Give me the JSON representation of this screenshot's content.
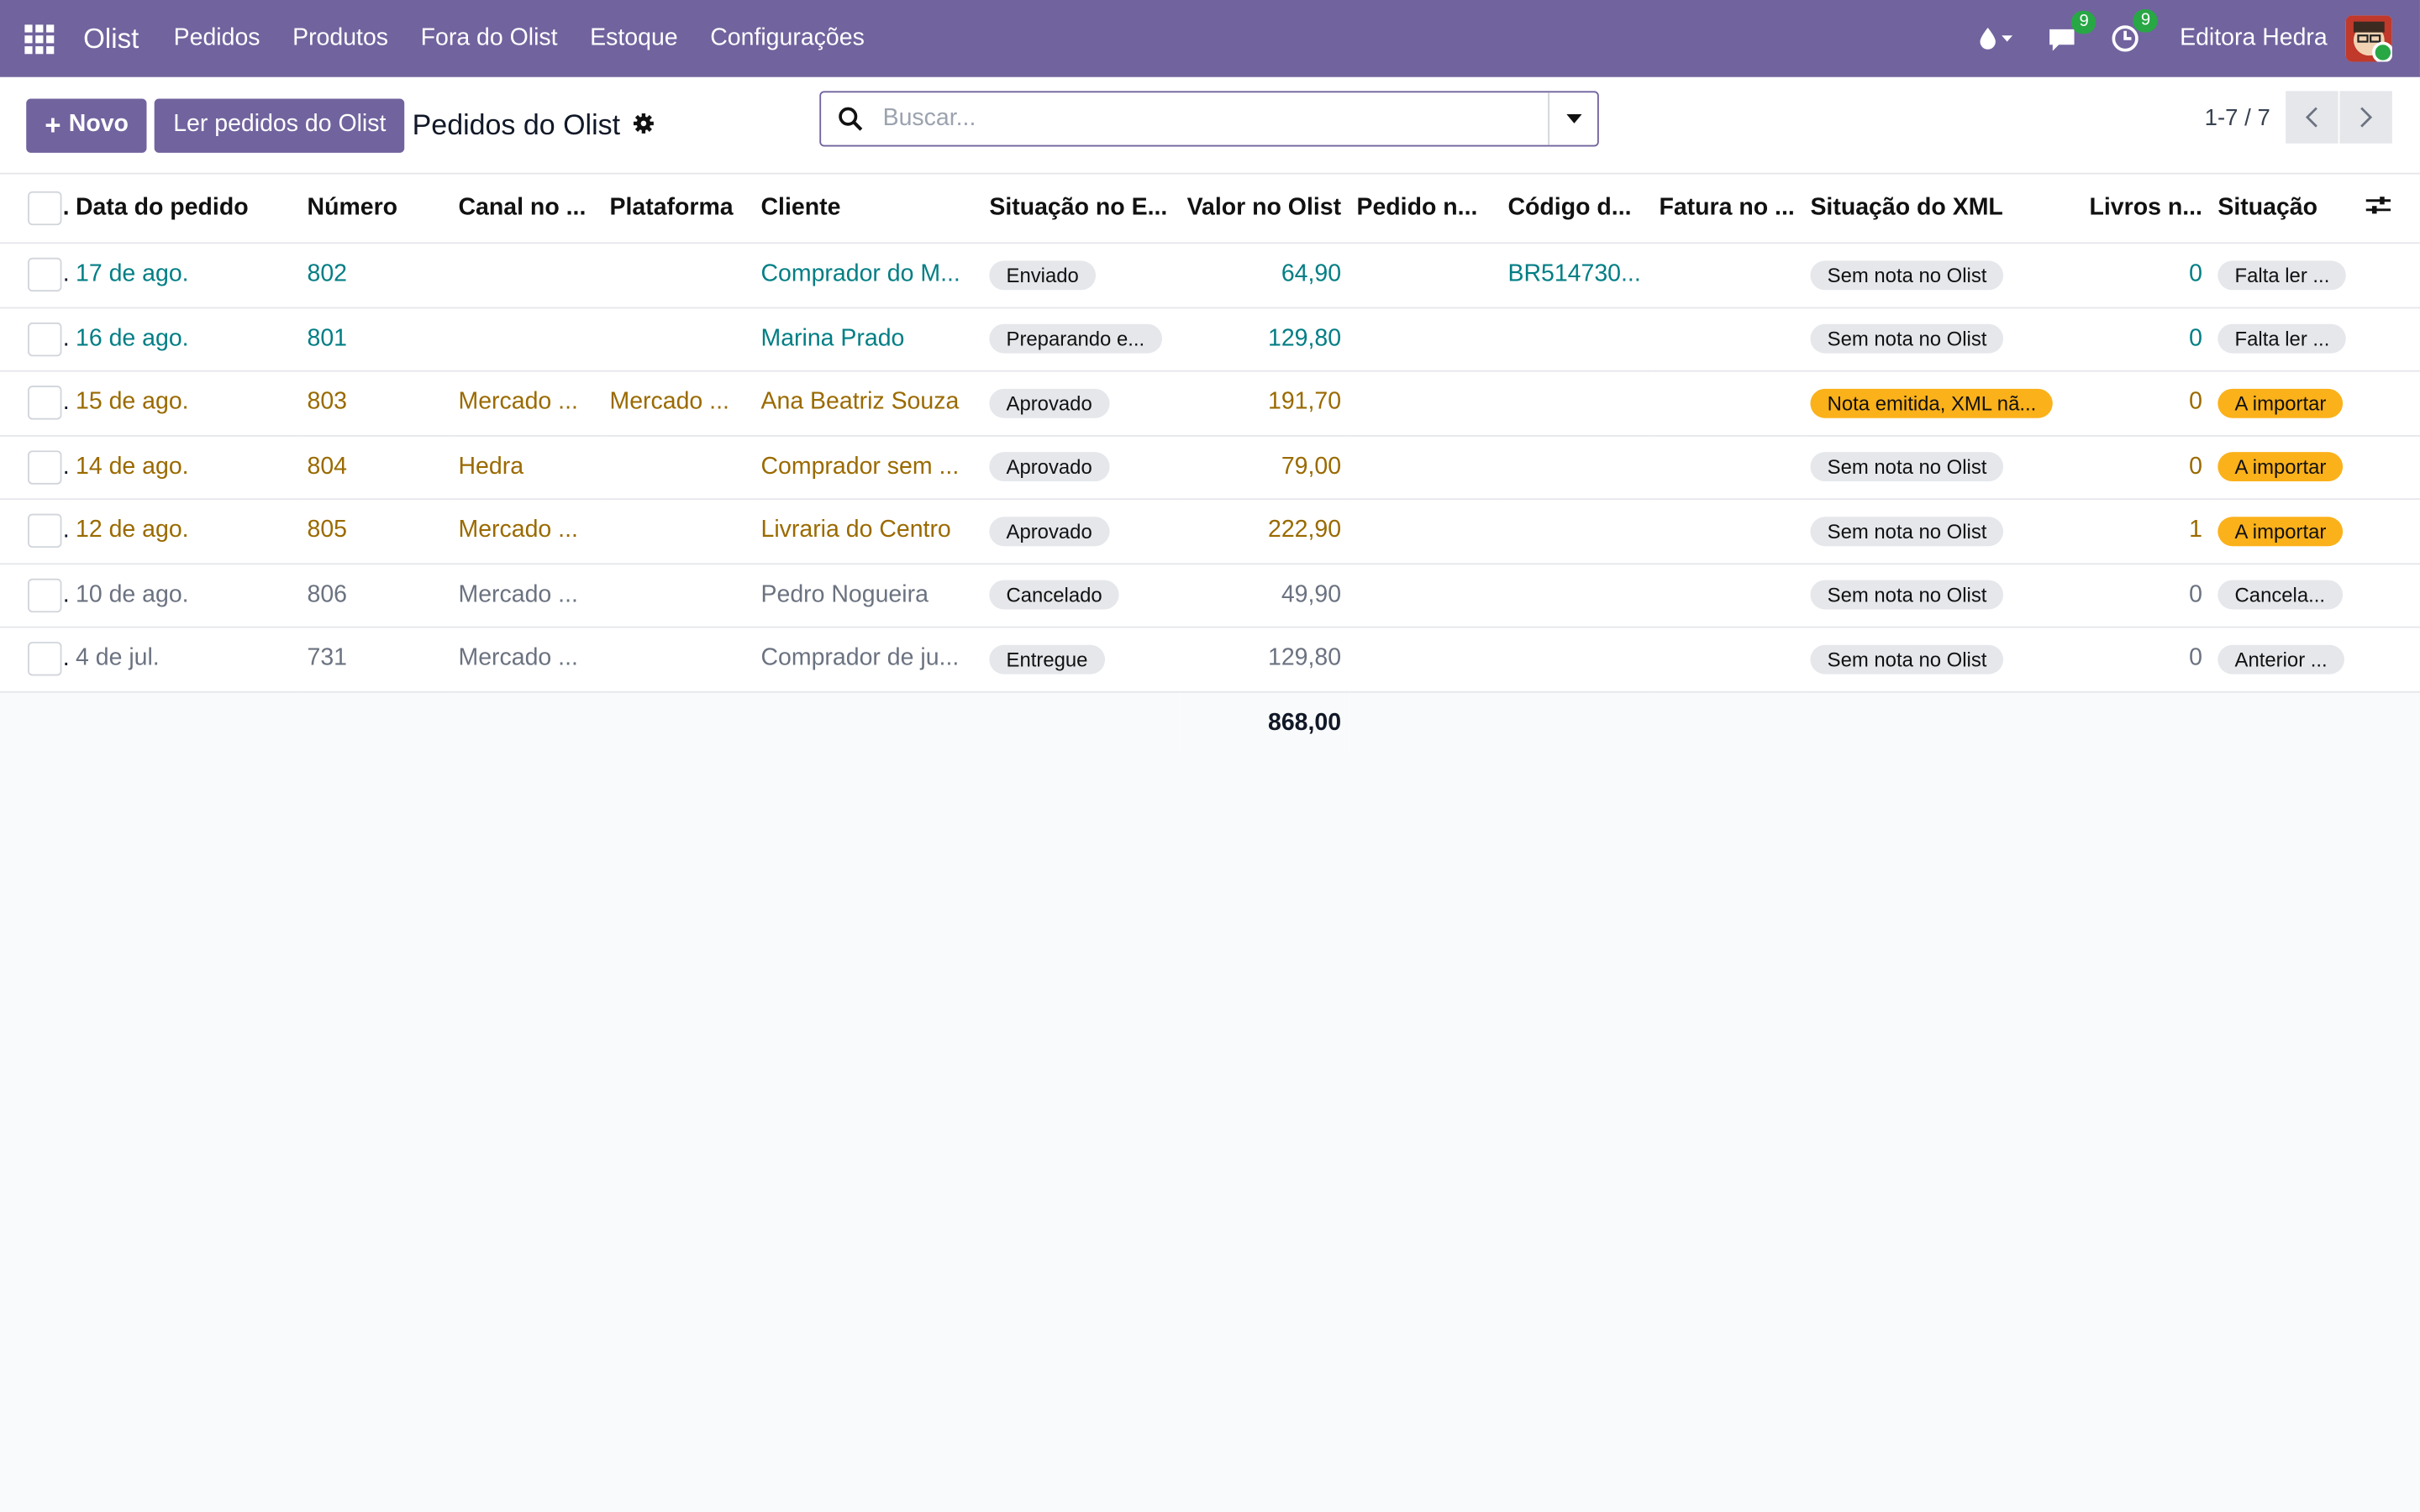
{
  "navbar": {
    "app_name": "Olist",
    "menu": [
      "Pedidos",
      "Produtos",
      "Fora do Olist",
      "Estoque",
      "Configurações"
    ],
    "messages_count": "9",
    "activities_count": "9",
    "company": "Editora Hedra"
  },
  "control_panel": {
    "new_label": "Novo",
    "read_orders_label": "Ler pedidos do Olist",
    "breadcrumb": "Pedidos do Olist",
    "search_placeholder": "Buscar...",
    "pager": "1-7 / 7"
  },
  "columns": [
    "Data do pedido",
    "Número",
    "Canal no ...",
    "Plataforma",
    "Cliente",
    "Situação no E...",
    "Valor no Olist",
    "Pedido n...",
    "Código d...",
    "Fatura no ...",
    "Situação do XML",
    "Livros n...",
    "Situação"
  ],
  "rows": [
    {
      "color": "blue",
      "date": "17 de ago.",
      "number": "802",
      "channel": "",
      "platform": "",
      "customer": "Comprador do M...",
      "situation": "Enviado",
      "value": "64,90",
      "order": "",
      "code": "BR514730...",
      "invoice": "",
      "xml": "Sem nota no Olist",
      "xml_warn": false,
      "books": "0",
      "status": "Falta ler ...",
      "status_warn": false
    },
    {
      "color": "blue",
      "date": "16 de ago.",
      "number": "801",
      "channel": "",
      "platform": "",
      "customer": "Marina Prado",
      "situation": "Preparando e...",
      "value": "129,80",
      "order": "",
      "code": "",
      "invoice": "",
      "xml": "Sem nota no Olist",
      "xml_warn": false,
      "books": "0",
      "status": "Falta ler ...",
      "status_warn": false
    },
    {
      "color": "gold",
      "date": "15 de ago.",
      "number": "803",
      "channel": "Mercado ...",
      "platform": "Mercado ...",
      "customer": "Ana Beatriz Souza",
      "situation": "Aprovado",
      "value": "191,70",
      "order": "",
      "code": "",
      "invoice": "",
      "xml": "Nota emitida, XML nã...",
      "xml_warn": true,
      "books": "0",
      "status": "A importar",
      "status_warn": true
    },
    {
      "color": "gold",
      "date": "14 de ago.",
      "number": "804",
      "channel": "Hedra",
      "platform": "",
      "customer": "Comprador sem ...",
      "situation": "Aprovado",
      "value": "79,00",
      "order": "",
      "code": "",
      "invoice": "",
      "xml": "Sem nota no Olist",
      "xml_warn": false,
      "books": "0",
      "status": "A importar",
      "status_warn": true
    },
    {
      "color": "gold",
      "date": "12 de ago.",
      "number": "805",
      "channel": "Mercado ...",
      "platform": "",
      "customer": "Livraria do Centro",
      "situation": "Aprovado",
      "value": "222,90",
      "order": "",
      "code": "",
      "invoice": "",
      "xml": "Sem nota no Olist",
      "xml_warn": false,
      "books": "1",
      "status": "A importar",
      "status_warn": true
    },
    {
      "color": "grey",
      "date": "10 de ago.",
      "number": "806",
      "channel": "Mercado ...",
      "platform": "",
      "customer": "Pedro Nogueira",
      "situation": "Cancelado",
      "value": "49,90",
      "order": "",
      "code": "",
      "invoice": "",
      "xml": "Sem nota no Olist",
      "xml_warn": false,
      "books": "0",
      "status": "Cancela...",
      "status_warn": false
    },
    {
      "color": "grey",
      "date": "4 de jul.",
      "number": "731",
      "channel": "Mercado ...",
      "platform": "",
      "customer": "Comprador de ju...",
      "situation": "Entregue",
      "value": "129,80",
      "order": "",
      "code": "",
      "invoice": "",
      "xml": "Sem nota no Olist",
      "xml_warn": false,
      "books": "0",
      "status": "Anterior ...",
      "status_warn": false
    }
  ],
  "total_value": "868,00",
  "colors": {
    "brand": "#71639e",
    "blue_row": "#017e84",
    "gold_row": "#9a6a00",
    "warning_badge": "#fbb11a"
  }
}
